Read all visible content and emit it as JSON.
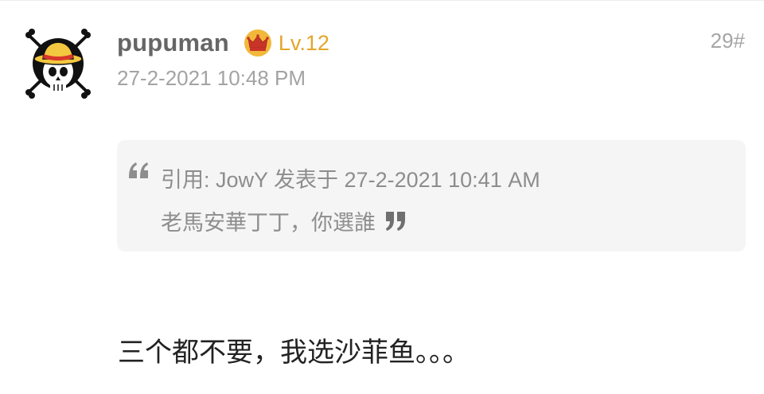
{
  "post": {
    "username": "pupuman",
    "level": "Lv.12",
    "floor": "29#",
    "timestamp": "27-2-2021 10:48 PM",
    "quote": {
      "header": "引用: JowY 发表于 27-2-2021 10:41 AM",
      "text": "老馬安華丁丁，你選誰"
    },
    "body": "三个都不要，我选沙菲鱼。。。"
  },
  "icons": {
    "avatar": "straw-hat-jolly-roger-avatar",
    "badge": "crown-icon",
    "quote_open": "open-quote-icon",
    "quote_close": "close-quote-icon"
  },
  "colors": {
    "username": "#666666",
    "level": "#e3a62b",
    "meta": "#a3a3a3",
    "quote_bg": "#f5f5f5",
    "quote_text": "#8d8d8d",
    "body_text": "#222222"
  }
}
